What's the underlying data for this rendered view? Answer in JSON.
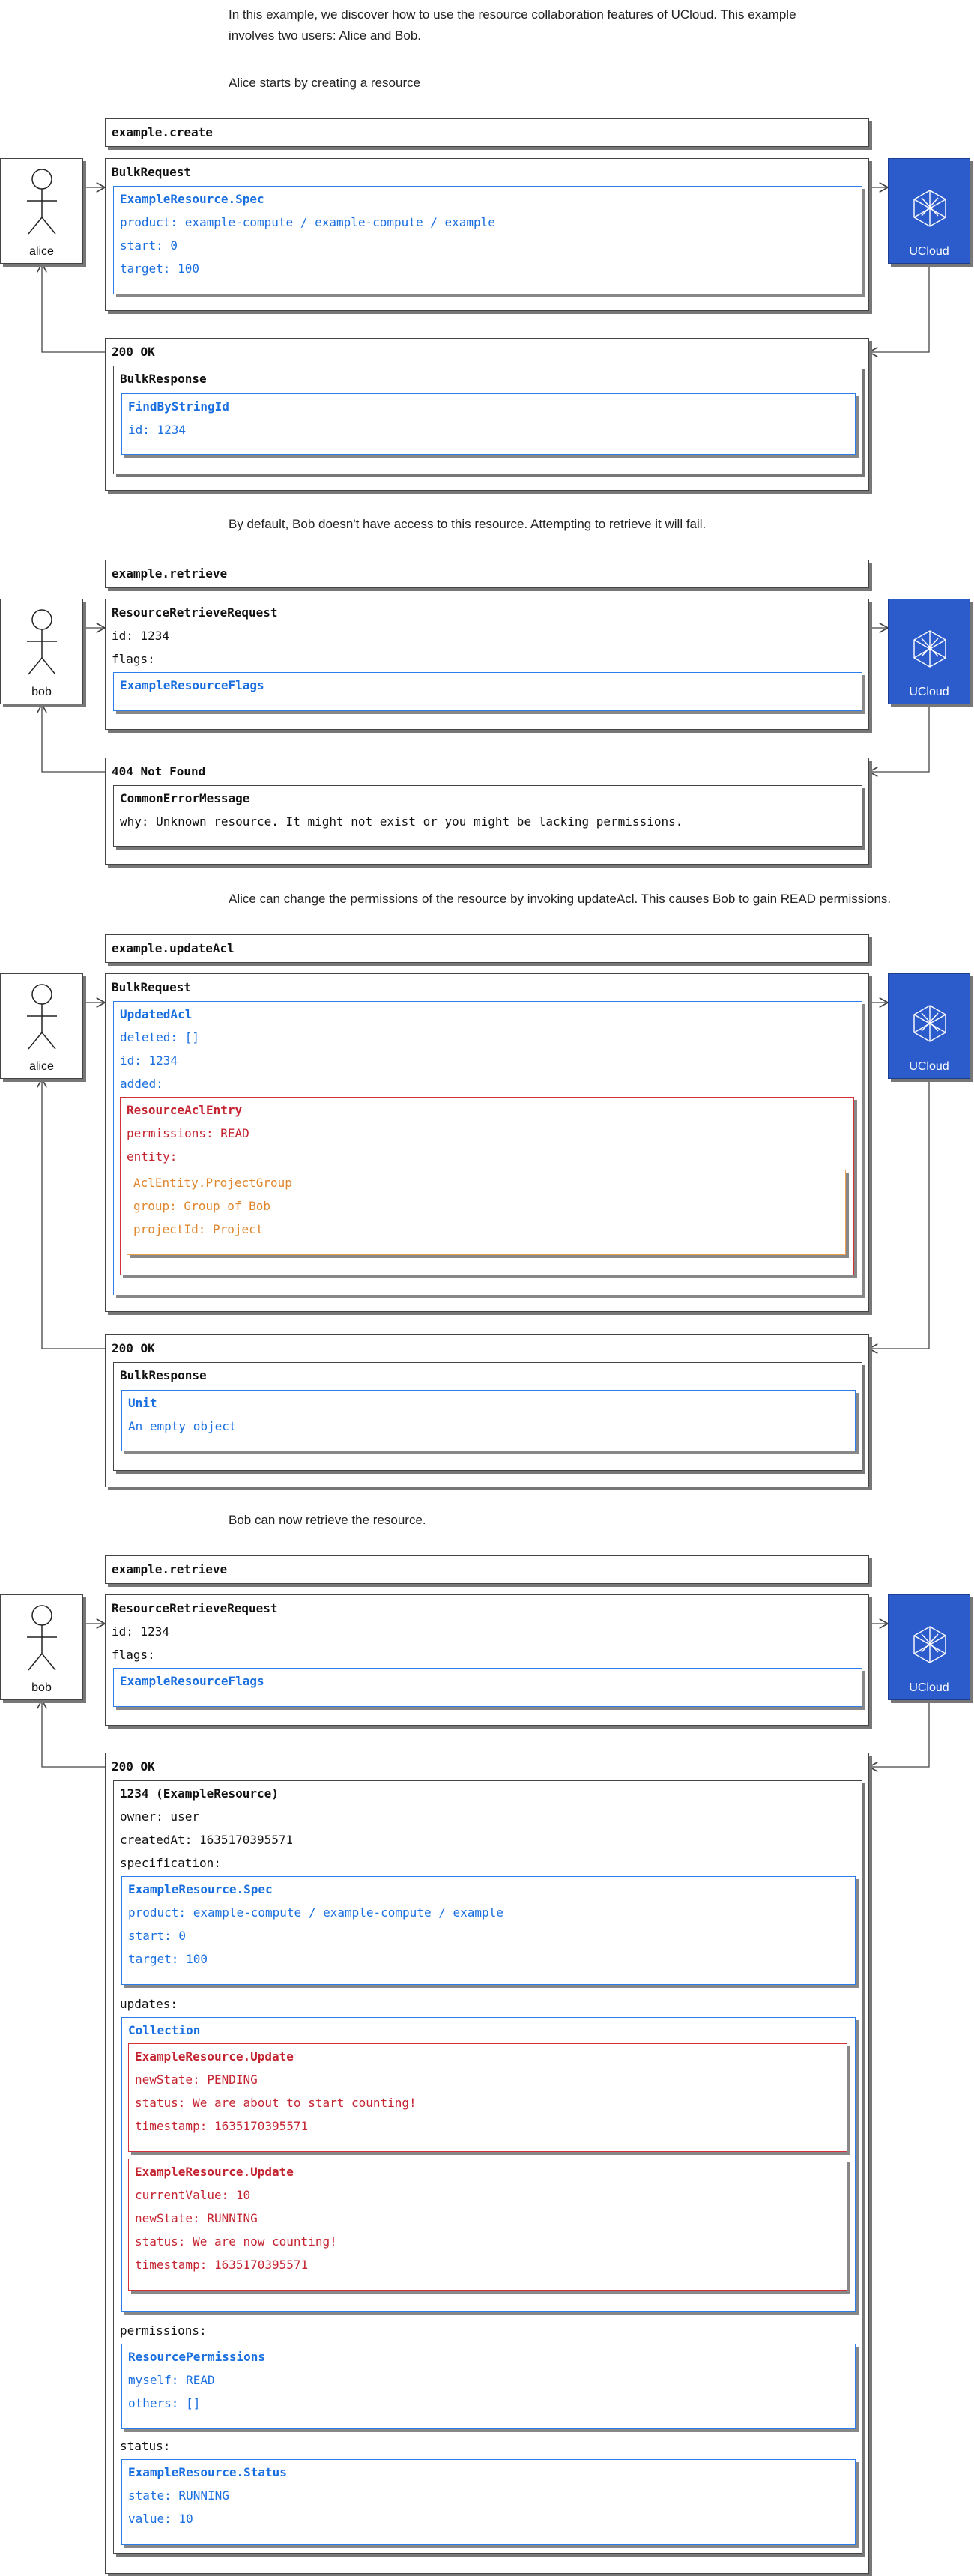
{
  "intro": "In this example, we discover how to use the resource collaboration features of UCloud. This example involves two users: Alice and Bob.",
  "ucloud_label": "UCloud",
  "s1": {
    "text": "Alice starts by creating a resource",
    "call": "example.create",
    "actor": "alice",
    "req_title": "BulkRequest",
    "req_obj": {
      "title": "ExampleResource.Spec",
      "product": "product: example-compute / example-compute / example",
      "start": "start: 0",
      "target": "target: 100"
    },
    "resp_status": "200 OK",
    "resp_title": "BulkResponse",
    "resp_obj": {
      "title": "FindByStringId",
      "id": "id: 1234"
    }
  },
  "s2": {
    "text": "By default, Bob doesn't have access to this resource. Attempting to retrieve it will fail.",
    "call": "example.retrieve",
    "actor": "bob",
    "req_title": "ResourceRetrieveRequest",
    "req_id": "id: 1234",
    "req_flags": "flags:",
    "req_obj": {
      "title": "ExampleResourceFlags"
    },
    "resp_status": "404 Not Found",
    "resp_title": "CommonErrorMessage",
    "resp_why": "why: Unknown resource. It might not exist or you might be lacking permissions."
  },
  "s3": {
    "text": "Alice can change the permissions of the resource by invoking updateAcl. This causes Bob to gain READ permissions.",
    "call": "example.updateAcl",
    "actor": "alice",
    "req_title": "BulkRequest",
    "acl": {
      "title": "UpdatedAcl",
      "deleted": "deleted: []",
      "id": "id: 1234",
      "added": "added:"
    },
    "entry": {
      "title": "ResourceAclEntry",
      "permissions": "permissions: READ",
      "entity": "entity:"
    },
    "group": {
      "title": "AclEntity.ProjectGroup",
      "group": "group: Group of Bob",
      "project": "projectId: Project"
    },
    "resp_status": "200 OK",
    "resp_title": "BulkResponse",
    "resp_obj": {
      "title": "Unit",
      "desc": "An empty object"
    }
  },
  "s4": {
    "text": "Bob can now retrieve the resource.",
    "call": "example.retrieve",
    "actor": "bob",
    "req_title": "ResourceRetrieveRequest",
    "req_id": "id: 1234",
    "req_flags": "flags:",
    "req_obj": {
      "title": "ExampleResourceFlags"
    },
    "resp_status": "200 OK",
    "res_title": "1234 (ExampleResource)",
    "owner": "owner: user",
    "created": "createdAt: 1635170395571",
    "spec_label": "specification:",
    "spec": {
      "title": "ExampleResource.Spec",
      "product": "product: example-compute / example-compute / example",
      "start": "start: 0",
      "target": "target: 100"
    },
    "updates_label": "updates:",
    "collection_title": "Collection",
    "u1": {
      "title": "ExampleResource.Update",
      "state": "newState: PENDING",
      "status": "status: We are about to start counting!",
      "ts": "timestamp: 1635170395571"
    },
    "u2": {
      "title": "ExampleResource.Update",
      "value": "currentValue: 10",
      "state": "newState: RUNNING",
      "status": "status: We are now counting!",
      "ts": "timestamp: 1635170395571"
    },
    "perm_label": "permissions:",
    "perm": {
      "title": "ResourcePermissions",
      "myself": "myself: READ",
      "others": "others: []"
    },
    "status_label": "status:",
    "st": {
      "title": "ExampleResource.Status",
      "state": "state: RUNNING",
      "value": "value: 10"
    }
  }
}
